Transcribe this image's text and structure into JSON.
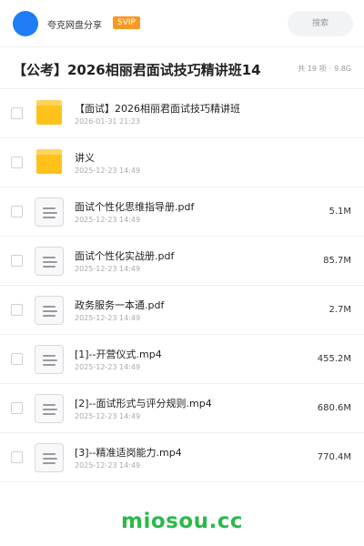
{
  "header": {
    "brand_text": "夸克网盘分享",
    "svip_label": "SVIP",
    "search_placeholder": "搜索"
  },
  "titlebar": {
    "title": "【公考】2026相丽君面试技巧精讲班14",
    "item_count": "共 19 项",
    "separator": "·",
    "total_size": "9.8G"
  },
  "files": [
    {
      "name": "【面试】2026相丽君面试技巧精讲班",
      "date": "2026-01-31 21:23",
      "size": "",
      "type": "folder",
      "icon": "folder-icon"
    },
    {
      "name": "讲义",
      "date": "2025-12-23 14:49",
      "size": "",
      "type": "folder",
      "icon": "folder-icon"
    },
    {
      "name": "面试个性化思维指导册.pdf",
      "date": "2025-12-23 14:49",
      "size": "5.1M",
      "type": "file",
      "icon": "document-icon"
    },
    {
      "name": "面试个性化实战册.pdf",
      "date": "2025-12-23 14:49",
      "size": "85.7M",
      "type": "file",
      "icon": "document-icon"
    },
    {
      "name": "政务服务一本通.pdf",
      "date": "2025-12-23 14:49",
      "size": "2.7M",
      "type": "file",
      "icon": "document-icon"
    },
    {
      "name": "[1]--开营仪式.mp4",
      "date": "2025-12-23 14:49",
      "size": "455.2M",
      "type": "file",
      "icon": "document-icon"
    },
    {
      "name": "[2]--面试形式与评分规则.mp4",
      "date": "2025-12-23 14:49",
      "size": "680.6M",
      "type": "file",
      "icon": "document-icon"
    },
    {
      "name": "[3]--精准适岗能力.mp4",
      "date": "2025-12-23 14:49",
      "size": "770.4M",
      "type": "file",
      "icon": "document-icon"
    }
  ],
  "footer": {
    "watermark": "miosou.cc"
  },
  "colors": {
    "avatar": "#1e7cf5",
    "svip": "#f59a23",
    "folder": "#ffc21a",
    "watermark": "#2db84c"
  }
}
